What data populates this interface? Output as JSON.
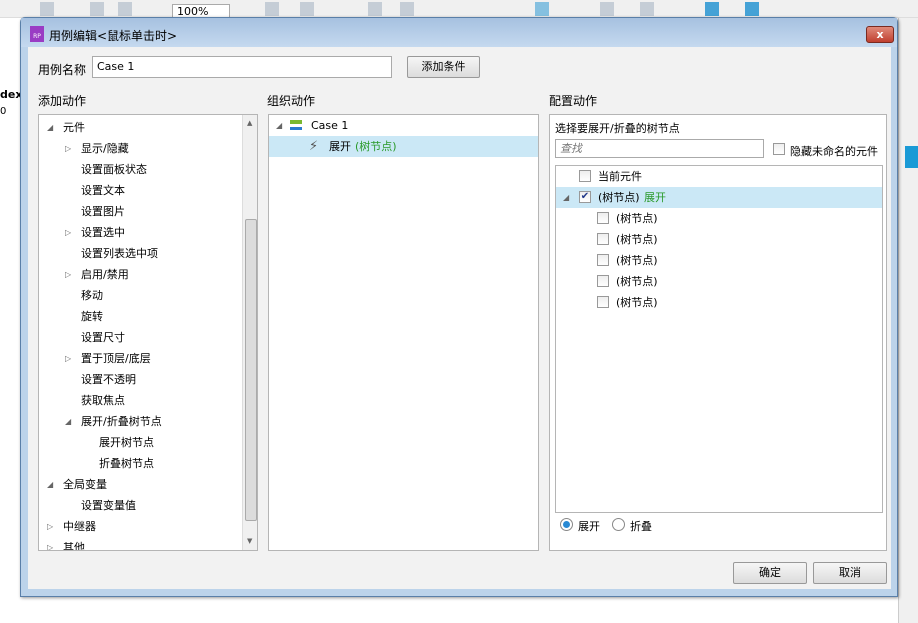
{
  "background": {
    "zoom_level": "100%",
    "side_text": "dex",
    "side_value": "0"
  },
  "dialog": {
    "title": "用例编辑<鼠标单击时>",
    "case_name_label": "用例名称",
    "case_name_value": "Case 1",
    "add_condition_label": "添加条件",
    "close_label": "x",
    "ok_label": "确定",
    "cancel_label": "取消"
  },
  "add_actions": {
    "header": "添加动作",
    "items": [
      {
        "label": "元件",
        "level": 0,
        "expander": "expanded"
      },
      {
        "label": "显示/隐藏",
        "level": 1,
        "expander": "collapsed"
      },
      {
        "label": "设置面板状态",
        "level": 1,
        "expander": "none"
      },
      {
        "label": "设置文本",
        "level": 1,
        "expander": "none"
      },
      {
        "label": "设置图片",
        "level": 1,
        "expander": "none"
      },
      {
        "label": "设置选中",
        "level": 1,
        "expander": "collapsed"
      },
      {
        "label": "设置列表选中项",
        "level": 1,
        "expander": "none"
      },
      {
        "label": "启用/禁用",
        "level": 1,
        "expander": "collapsed"
      },
      {
        "label": "移动",
        "level": 1,
        "expander": "none"
      },
      {
        "label": "旋转",
        "level": 1,
        "expander": "none"
      },
      {
        "label": "设置尺寸",
        "level": 1,
        "expander": "none"
      },
      {
        "label": "置于顶层/底层",
        "level": 1,
        "expander": "collapsed"
      },
      {
        "label": "设置不透明",
        "level": 1,
        "expander": "none"
      },
      {
        "label": "获取焦点",
        "level": 1,
        "expander": "none"
      },
      {
        "label": "展开/折叠树节点",
        "level": 1,
        "expander": "expanded"
      },
      {
        "label": "展开树节点",
        "level": 2,
        "expander": "none"
      },
      {
        "label": "折叠树节点",
        "level": 2,
        "expander": "none"
      },
      {
        "label": "全局变量",
        "level": 0,
        "expander": "expanded"
      },
      {
        "label": "设置变量值",
        "level": 1,
        "expander": "none"
      },
      {
        "label": "中继器",
        "level": 0,
        "expander": "collapsed"
      },
      {
        "label": "其他",
        "level": 0,
        "expander": "collapsed"
      }
    ]
  },
  "organize_actions": {
    "header": "组织动作",
    "case_label": "Case 1",
    "action_label": "展开",
    "action_target": "(树节点)"
  },
  "configure_actions": {
    "header": "配置动作",
    "subheader": "选择要展开/折叠的树节点",
    "search_placeholder": "查找",
    "hide_unnamed_label": "隐藏未命名的元件",
    "tree": [
      {
        "label": "当前元件",
        "checked": false,
        "level": 0,
        "extra": ""
      },
      {
        "label": "(树节点)",
        "checked": true,
        "level": 0,
        "extra": "展开",
        "selected": true
      },
      {
        "label": "(树节点)",
        "checked": false,
        "level": 1,
        "extra": ""
      },
      {
        "label": "(树节点)",
        "checked": false,
        "level": 1,
        "extra": ""
      },
      {
        "label": "(树节点)",
        "checked": false,
        "level": 1,
        "extra": ""
      },
      {
        "label": "(树节点)",
        "checked": false,
        "level": 1,
        "extra": ""
      },
      {
        "label": "(树节点)",
        "checked": false,
        "level": 1,
        "extra": ""
      }
    ],
    "radio_expand": "展开",
    "radio_collapse": "折叠",
    "selected_radio": "expand"
  }
}
